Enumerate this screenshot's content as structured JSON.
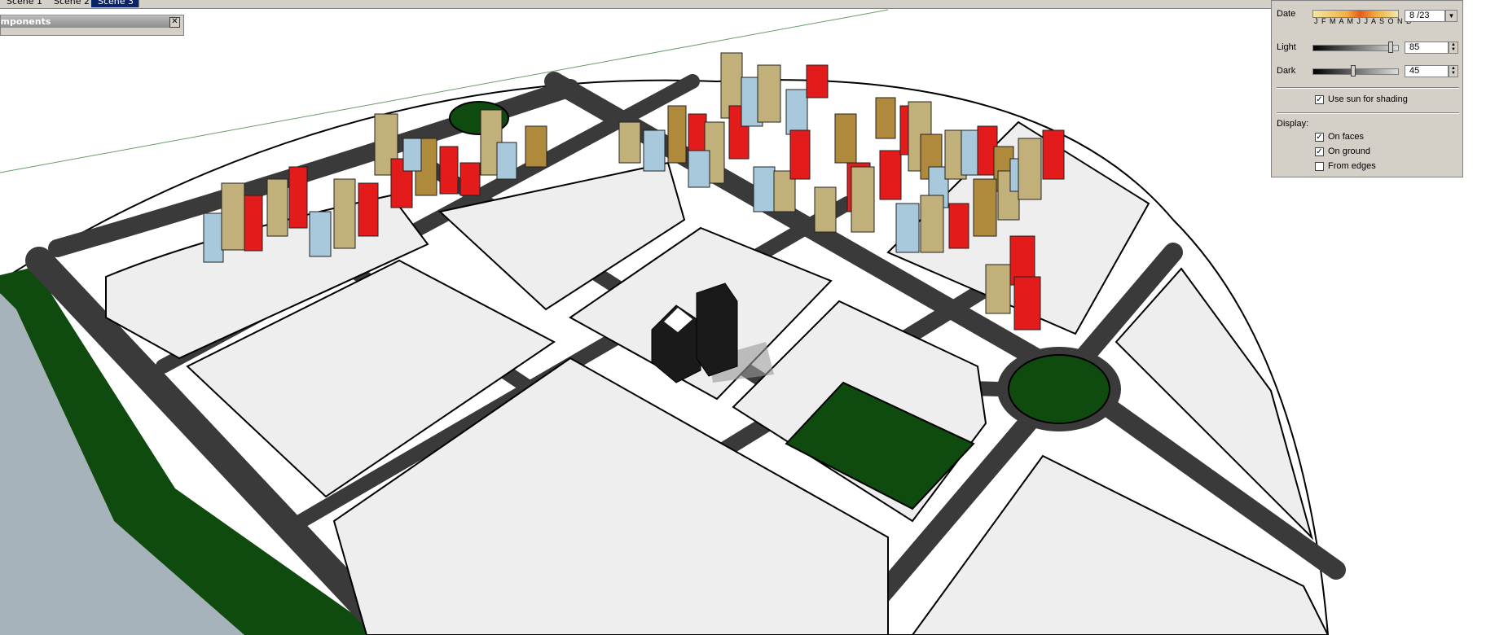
{
  "scene_tabs": [
    "Scene 1",
    "Scene 2",
    "Scene 3"
  ],
  "components_window": {
    "title": "omponents",
    "close_glyph": "✕"
  },
  "shadow_settings": {
    "date_label": "Date",
    "months": "J F M A M J J A S O N D",
    "date_value": "8 /23",
    "light_label": "Light",
    "light_value": "85",
    "dark_label": "Dark",
    "dark_value": "45",
    "use_sun_label": "Use sun for shading",
    "use_sun_checked": true,
    "display_label": "Display:",
    "on_faces_label": "On faces",
    "on_faces_checked": true,
    "on_ground_label": "On ground",
    "on_ground_checked": true,
    "from_edges_label": "From edges",
    "from_edges_checked": false
  },
  "colors": {
    "road": "#3a3a3a",
    "green": "#0f4a0f",
    "block": "#eeeeee",
    "building_red": "#e31b1b",
    "building_tan": "#c2b07a",
    "building_blue": "#a8c8dc",
    "building_brown": "#b08a3c",
    "water": "#a7b3ba"
  }
}
